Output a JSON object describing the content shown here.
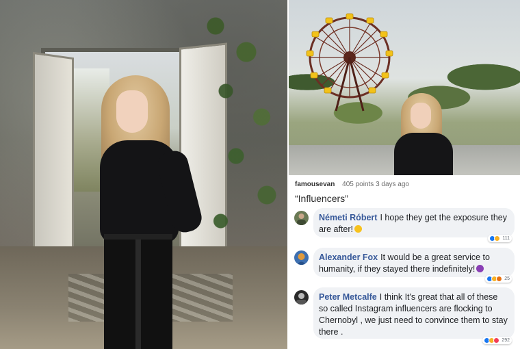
{
  "post": {
    "username": "famousevan",
    "stats": "405 points 3 days ago",
    "title": "“Influencers”"
  },
  "comments": [
    {
      "author": "Németi Róbert",
      "text": "I hope they get the exposure they are after!",
      "emoji": "smiley-face-emoji",
      "reactions": [
        "like",
        "haha"
      ],
      "count": "111"
    },
    {
      "author": "Alexander Fox",
      "text": "It would be a great service to humanity, if they stayed there indefinitely!",
      "emoji": "devil-face-emoji",
      "reactions": [
        "like",
        "haha",
        "angry"
      ],
      "count": "25"
    },
    {
      "author": "Peter Metcalfe",
      "text": "I think It's great that all of these so called Instagram influencers are flocking to Chernobyl , we just need to convince them to stay there .",
      "emoji": "",
      "reactions": [
        "like",
        "haha",
        "love"
      ],
      "count": "292"
    }
  ],
  "colors": {
    "comment_name": "#365899",
    "bubble_bg": "#f0f2f5",
    "like": "#1877f2",
    "haha": "#f7b125",
    "love": "#f33e58"
  }
}
